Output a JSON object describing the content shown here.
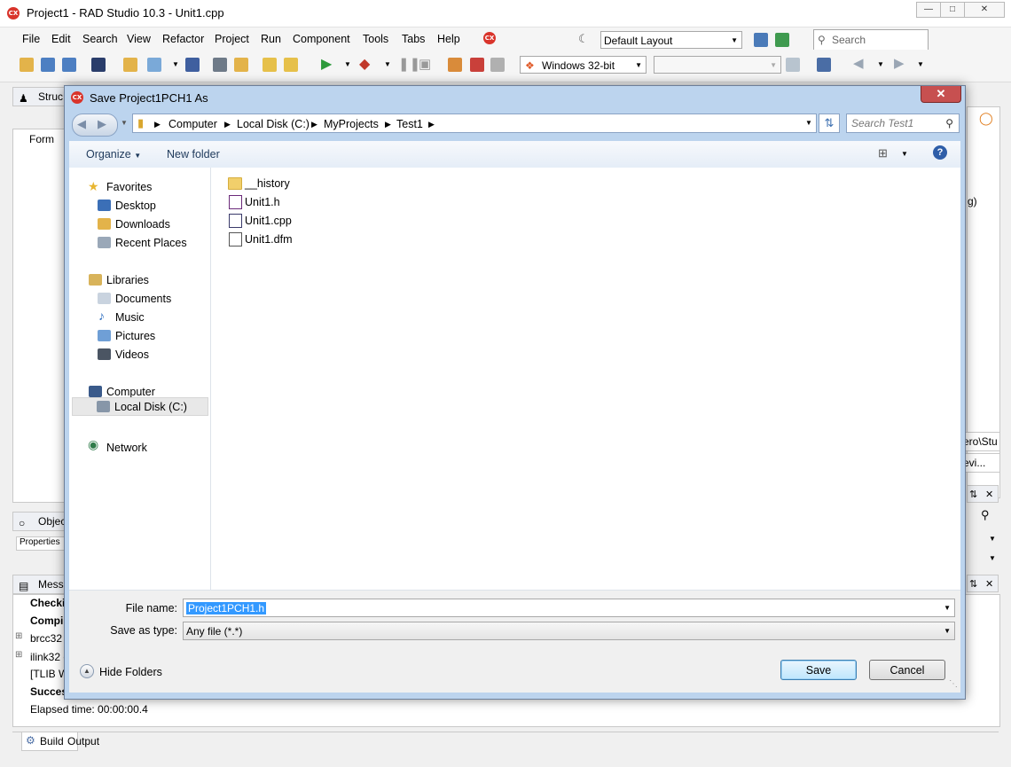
{
  "ide": {
    "title": "Project1 - RAD Studio 10.3 - Unit1.cpp",
    "menu": [
      "File",
      "Edit",
      "Search",
      "View",
      "Refactor",
      "Project",
      "Run",
      "Component",
      "Tools",
      "Tabs",
      "Help"
    ],
    "layout_combo": "Default Layout",
    "search_placeholder": "Search",
    "platform_combo": "Windows 32-bit",
    "structure_tab": "Struc",
    "structure_item": "Form",
    "object_tab": "Objec",
    "properties_tab": "Properties",
    "messages_tab": "Messa",
    "messages": [
      "Checki",
      "Compi",
      "brcc32 c",
      "ilink32 c",
      "[TLIB W",
      "Succes",
      "Elapsed time: 00:00:00.4"
    ],
    "right_snippets": [
      "g)",
      "ero\\Stu",
      "evi..."
    ],
    "bottom_tabs": [
      "Build",
      "Output"
    ],
    "accent_color": "#d9342b"
  },
  "dialog": {
    "title": "Save Project1PCH1 As",
    "breadcrumb": [
      "Computer",
      "Local Disk (C:)",
      "MyProjects",
      "Test1"
    ],
    "search_placeholder": "Search Test1",
    "organize_label": "Organize",
    "new_folder_label": "New folder",
    "nav": {
      "favorites_header": "Favorites",
      "favorites": [
        "Desktop",
        "Downloads",
        "Recent Places"
      ],
      "libraries_header": "Libraries",
      "libraries": [
        "Documents",
        "Music",
        "Pictures",
        "Videos"
      ],
      "computer_header": "Computer",
      "computer_items": [
        "Local Disk (C:)"
      ],
      "network_header": "Network"
    },
    "files": [
      "__history",
      "Unit1.h",
      "Unit1.cpp",
      "Unit1.dfm"
    ],
    "file_name_label": "File name:",
    "file_name_value": "Project1PCH1.h",
    "save_type_label": "Save as type:",
    "save_type_value": "Any file (*.*)",
    "hide_folders_label": "Hide Folders",
    "save_label": "Save",
    "cancel_label": "Cancel"
  }
}
